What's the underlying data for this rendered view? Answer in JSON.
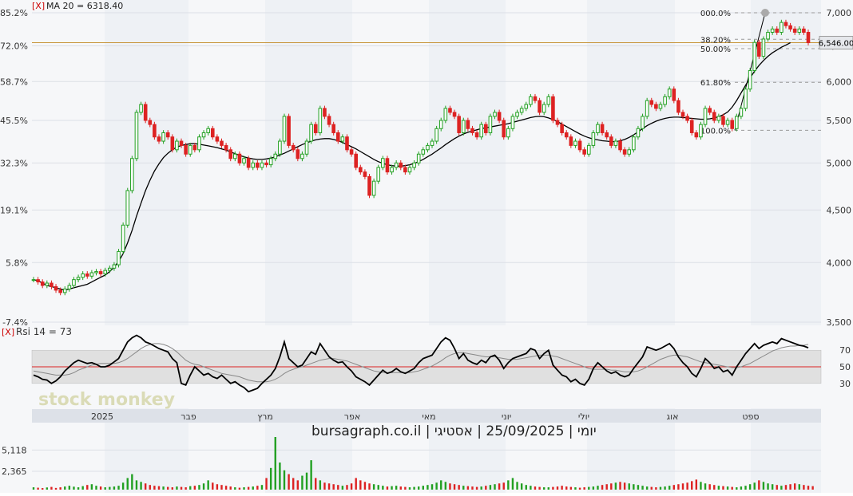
{
  "header": {
    "close_marker": "[X]",
    "ma_label": "MA 20 = 6318.40",
    "rsi_label": "Rsi 14 = 73",
    "watermark": "stock monkey",
    "footer_text": "יומי | 25/09/2025 | אסטיגי | bursagraph.co.il"
  },
  "colors": {
    "up": "#22a022",
    "down": "#dd2222",
    "ma": "#000000",
    "rsi": "#000000",
    "rsi_signal": "#888888",
    "rsi_mid": "#dd2222",
    "current_line": "#c8963c",
    "band": "#e0e0e0",
    "grid": "#dcdfe6",
    "stripe": "#eef1f5"
  },
  "chart_data": [
    {
      "type": "candlestick",
      "title": "",
      "y_ticks": [
        "7,000",
        "6,500",
        "6,000",
        "5,500",
        "5,000",
        "4,500",
        "4,000",
        "3,500"
      ],
      "y_tick_values": [
        7000,
        6500,
        6000,
        5500,
        5000,
        4500,
        4000,
        3500
      ],
      "left_ticks": [
        "85.2%",
        "72.0%",
        "58.7%",
        "45.5%",
        "32.3%",
        "19.1%",
        "5.8%",
        "-7.4%"
      ],
      "ylim": [
        3500,
        7000
      ],
      "last_price": "6,546.00",
      "last_price_value": 6546,
      "fibonacci": [
        {
          "label": "000.0%",
          "value": 7000
        },
        {
          "label": "38.20%",
          "value": 6596
        },
        {
          "label": "50.00%",
          "value": 6460
        },
        {
          "label": "61.80%",
          "value": 5990
        },
        {
          "label": "100.0%",
          "value": 5380
        }
      ],
      "x_labels": [
        "2025",
        "פבר",
        "מרץ",
        "אפר",
        "מאי",
        "יוני",
        "יולי",
        "אוג",
        "ספט"
      ],
      "close": [
        3850,
        3830,
        3800,
        3820,
        3790,
        3760,
        3740,
        3770,
        3800,
        3850,
        3870,
        3900,
        3880,
        3910,
        3920,
        3900,
        3930,
        3950,
        3980,
        4100,
        4350,
        4700,
        5050,
        5600,
        5700,
        5500,
        5450,
        5300,
        5250,
        5350,
        5300,
        5150,
        5250,
        5200,
        5100,
        5200,
        5150,
        5300,
        5350,
        5400,
        5300,
        5250,
        5200,
        5150,
        5050,
        5100,
        5000,
        5050,
        4950,
        5000,
        4950,
        5000,
        4980,
        5050,
        5100,
        5250,
        5550,
        5200,
        5150,
        5050,
        5100,
        5250,
        5450,
        5350,
        5650,
        5550,
        5450,
        5350,
        5250,
        5300,
        5150,
        5100,
        4950,
        4900,
        4850,
        4650,
        4800,
        4950,
        5050,
        4900,
        4950,
        5000,
        4950,
        4900,
        4950,
        5000,
        5100,
        5150,
        5200,
        5250,
        5400,
        5500,
        5650,
        5600,
        5550,
        5350,
        5500,
        5400,
        5350,
        5300,
        5450,
        5350,
        5550,
        5600,
        5500,
        5300,
        5400,
        5550,
        5600,
        5650,
        5700,
        5800,
        5750,
        5600,
        5700,
        5800,
        5500,
        5450,
        5350,
        5300,
        5200,
        5250,
        5150,
        5100,
        5200,
        5350,
        5450,
        5350,
        5300,
        5200,
        5250,
        5150,
        5100,
        5150,
        5300,
        5400,
        5550,
        5750,
        5700,
        5650,
        5700,
        5800,
        5900,
        5750,
        5600,
        5550,
        5500,
        5350,
        5300,
        5450,
        5650,
        5600,
        5500,
        5550,
        5450,
        5500,
        5400,
        5550,
        5650,
        5900,
        6150,
        6550,
        6350,
        6600,
        6700,
        6750,
        6700,
        6850,
        6800,
        6750,
        6700,
        6750,
        6700,
        6546
      ],
      "ma20": [
        3850,
        3840,
        3820,
        3800,
        3790,
        3780,
        3770,
        3760,
        3770,
        3780,
        3790,
        3800,
        3810,
        3830,
        3850,
        3870,
        3890,
        3920,
        3960,
        4010,
        4080,
        4180,
        4300,
        4440,
        4570,
        4700,
        4810,
        4910,
        4990,
        5060,
        5110,
        5150,
        5180,
        5200,
        5210,
        5220,
        5220,
        5215,
        5205,
        5195,
        5185,
        5175,
        5160,
        5145,
        5125,
        5105,
        5085,
        5070,
        5055,
        5045,
        5040,
        5040,
        5045,
        5055,
        5070,
        5090,
        5110,
        5135,
        5160,
        5185,
        5210,
        5230,
        5250,
        5265,
        5275,
        5280,
        5280,
        5270,
        5255,
        5235,
        5210,
        5185,
        5160,
        5130,
        5100,
        5070,
        5040,
        5015,
        4995,
        4980,
        4970,
        4965,
        4965,
        4970,
        4980,
        4995,
        5015,
        5040,
        5070,
        5100,
        5135,
        5170,
        5210,
        5245,
        5280,
        5310,
        5335,
        5355,
        5370,
        5385,
        5400,
        5410,
        5420,
        5430,
        5440,
        5450,
        5460,
        5475,
        5490,
        5505,
        5520,
        5535,
        5545,
        5550,
        5545,
        5530,
        5510,
        5485,
        5455,
        5425,
        5395,
        5365,
        5335,
        5310,
        5290,
        5275,
        5265,
        5255,
        5250,
        5245,
        5245,
        5255,
        5270,
        5295,
        5325,
        5360,
        5400,
        5435,
        5465,
        5490,
        5510,
        5525,
        5535,
        5540,
        5540,
        5535,
        5530,
        5525,
        5520,
        5515,
        5515,
        5520,
        5530,
        5545,
        5570,
        5605,
        5665,
        5750,
        5850,
        5950,
        6050,
        6140,
        6220,
        6290,
        6350,
        6400,
        6440,
        6480,
        6510,
        6546
      ]
    },
    {
      "type": "line",
      "title": "",
      "ylim": [
        0,
        100
      ],
      "y_ticks": [
        "70",
        "50",
        "30"
      ],
      "y_tick_values": [
        70,
        50,
        30
      ],
      "band": [
        30,
        70
      ],
      "rsi": [
        40,
        38,
        35,
        34,
        30,
        33,
        38,
        45,
        50,
        55,
        58,
        56,
        54,
        55,
        53,
        50,
        50,
        52,
        56,
        60,
        70,
        80,
        85,
        88,
        85,
        80,
        78,
        75,
        72,
        70,
        68,
        60,
        55,
        30,
        28,
        40,
        50,
        45,
        40,
        42,
        38,
        36,
        40,
        35,
        30,
        32,
        28,
        25,
        20,
        22,
        24,
        30,
        35,
        40,
        48,
        62,
        80,
        60,
        55,
        50,
        52,
        60,
        68,
        65,
        78,
        70,
        62,
        58,
        55,
        56,
        50,
        45,
        38,
        35,
        32,
        28,
        34,
        40,
        46,
        42,
        44,
        48,
        44,
        42,
        45,
        48,
        55,
        60,
        62,
        64,
        72,
        80,
        85,
        82,
        72,
        60,
        66,
        58,
        55,
        53,
        58,
        55,
        62,
        64,
        58,
        48,
        55,
        60,
        62,
        64,
        66,
        72,
        70,
        60,
        66,
        70,
        52,
        46,
        40,
        38,
        32,
        35,
        30,
        28,
        35,
        48,
        55,
        50,
        45,
        42,
        44,
        40,
        38,
        40,
        48,
        55,
        62,
        74,
        72,
        70,
        72,
        75,
        78,
        72,
        62,
        55,
        50,
        42,
        38,
        48,
        60,
        55,
        48,
        50,
        44,
        46,
        40,
        50,
        58,
        66,
        72,
        78,
        72,
        76,
        78,
        80,
        78,
        84,
        82,
        80,
        78,
        76,
        75,
        73
      ],
      "rsi_signal": [
        45,
        44,
        43,
        42,
        41,
        40,
        40,
        40,
        41,
        43,
        46,
        48,
        50,
        52,
        53,
        54,
        54,
        54,
        54,
        55,
        57,
        60,
        64,
        68,
        72,
        75,
        77,
        78,
        78,
        77,
        75,
        72,
        68,
        63,
        58,
        55,
        53,
        52,
        50,
        48,
        46,
        44,
        42,
        41,
        40,
        39,
        38,
        36,
        34,
        33,
        32,
        32,
        32,
        33,
        35,
        38,
        42,
        45,
        47,
        49,
        50,
        52,
        54,
        56,
        58,
        59,
        60,
        60,
        59,
        58,
        57,
        55,
        53,
        51,
        49,
        47,
        45,
        44,
        43,
        43,
        43,
        43,
        43,
        43,
        43,
        44,
        45,
        47,
        49,
        51,
        54,
        57,
        61,
        64,
        66,
        67,
        67,
        66,
        65,
        64,
        63,
        62,
        62,
        62,
        61,
        60,
        59,
        59,
        59,
        60,
        61,
        62,
        63,
        64,
        64,
        64,
        63,
        62,
        60,
        58,
        56,
        54,
        52,
        50,
        48,
        47,
        47,
        47,
        47,
        46,
        46,
        45,
        44,
        44,
        44,
        45,
        47,
        50,
        53,
        56,
        59,
        61,
        63,
        64,
        64,
        63,
        62,
        60,
        58,
        56,
        55,
        54,
        53,
        52,
        51,
        50,
        49,
        49,
        50,
        52,
        54,
        57,
        60,
        63,
        66,
        69,
        71,
        73,
        74,
        75,
        75,
        76,
        76,
        77
      ]
    },
    {
      "type": "bar",
      "title": "",
      "y_ticks": [
        "5,118",
        "2,365"
      ],
      "y_tick_values": [
        5118,
        2365
      ],
      "ylim": [
        0,
        6800
      ],
      "volume": [
        300,
        250,
        200,
        280,
        350,
        220,
        300,
        400,
        500,
        380,
        300,
        450,
        600,
        700,
        500,
        400,
        300,
        350,
        400,
        500,
        900,
        1500,
        2000,
        1200,
        1000,
        800,
        600,
        500,
        450,
        400,
        350,
        300,
        400,
        350,
        300,
        450,
        500,
        600,
        800,
        1200,
        900,
        700,
        600,
        500,
        400,
        300,
        250,
        300,
        350,
        400,
        500,
        600,
        1500,
        2800,
        6800,
        3500,
        2500,
        2000,
        1500,
        1200,
        1800,
        2200,
        3800,
        1500,
        1200,
        900,
        800,
        700,
        600,
        500,
        600,
        800,
        1500,
        1200,
        1000,
        800,
        700,
        600,
        500,
        400,
        450,
        500,
        400,
        350,
        300,
        350,
        400,
        500,
        600,
        700,
        900,
        1200,
        1000,
        800,
        700,
        600,
        500,
        450,
        400,
        350,
        400,
        500,
        600,
        700,
        800,
        900,
        1200,
        1500,
        1000,
        800,
        600,
        500,
        400,
        350,
        300,
        300,
        350,
        400,
        500,
        400,
        350,
        300,
        250,
        300,
        350,
        400,
        500,
        600,
        700,
        800,
        900,
        1000,
        900,
        800,
        700,
        600,
        500,
        400,
        350,
        300,
        350,
        400,
        500,
        600,
        700,
        800,
        900,
        1100,
        1300,
        1000,
        800,
        700,
        600,
        500,
        450,
        400,
        350,
        300,
        400,
        500,
        700,
        900,
        1200,
        1000,
        800,
        700,
        600,
        500,
        600,
        700,
        800,
        700,
        600,
        500,
        450
      ]
    }
  ]
}
